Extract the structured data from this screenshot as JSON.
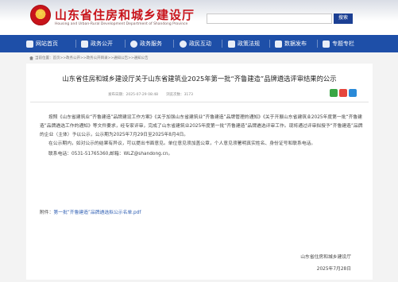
{
  "header": {
    "title": "山东省住房和城乡建设厅",
    "subtitle": "Housing and Urban-Rural Development Department of Shandong Province",
    "search_placeholder": "",
    "search_button": "搜索"
  },
  "nav": {
    "items": [
      {
        "label": "网站首页",
        "icon": "home-icon"
      },
      {
        "label": "政务公开",
        "icon": "document-icon"
      },
      {
        "label": "政务服务",
        "icon": "service-icon"
      },
      {
        "label": "政民互动",
        "icon": "chat-icon"
      },
      {
        "label": "政策法规",
        "icon": "book-icon"
      },
      {
        "label": "数据发布",
        "icon": "chart-icon"
      },
      {
        "label": "专题专栏",
        "icon": "grid-icon"
      }
    ]
  },
  "breadcrumb": "当前位置：首页>>政务公开>>政务公开目录>>通知公告>>通知公告",
  "article": {
    "title": "山东省住房和城乡建设厅关于山东省建筑业2025年第一批“齐鲁建造”品牌遴选评审结果的公示",
    "date_label": "发布日期：2025-07-29 08:48",
    "views_label": "浏览次数：",
    "views_value": "3173",
    "paragraph1": "按照《山东省建筑业“齐鲁建造”品牌建设工作方案》《关于加强山东省建筑业“齐鲁建造”品牌管理的通知》《关于开展山东省建筑业2025年度第一批“齐鲁建造”品牌遴选工作的通知》等文件要求，经专家评审，完成了山东省建筑业2025年度第一批“齐鲁建造”品牌遴选评审工作。现将通过评审拟授予“齐鲁建造”品牌的企业（主体）予以公示，公示期为2025年7月29日至2025年8月4日。",
    "paragraph2": "在公示期内，如对公示的结果有异议，可以提出书面意见。单位意见须加盖公章，个人意见须署明真实姓名、身份证号和联系电话。",
    "contact": "联系电话：0531-51765360,邮箱：WLZ@shandong.cn。",
    "attachment_label": "附件：",
    "attachment_link": "第一批“齐鲁建造”品牌遴选拟公示名单.pdf",
    "signature_org": "山东省住房和城乡建设厅",
    "signature_date": "2025年7月28日"
  },
  "colors": {
    "brand_red": "#c8141b",
    "nav_blue": "#1e4fa8",
    "search_blue": "#1b3f93",
    "link_blue": "#2f5fb3",
    "share_wechat": "#3aa645",
    "share_weibo": "#e6463d",
    "share_qq": "#2a8ad8"
  }
}
